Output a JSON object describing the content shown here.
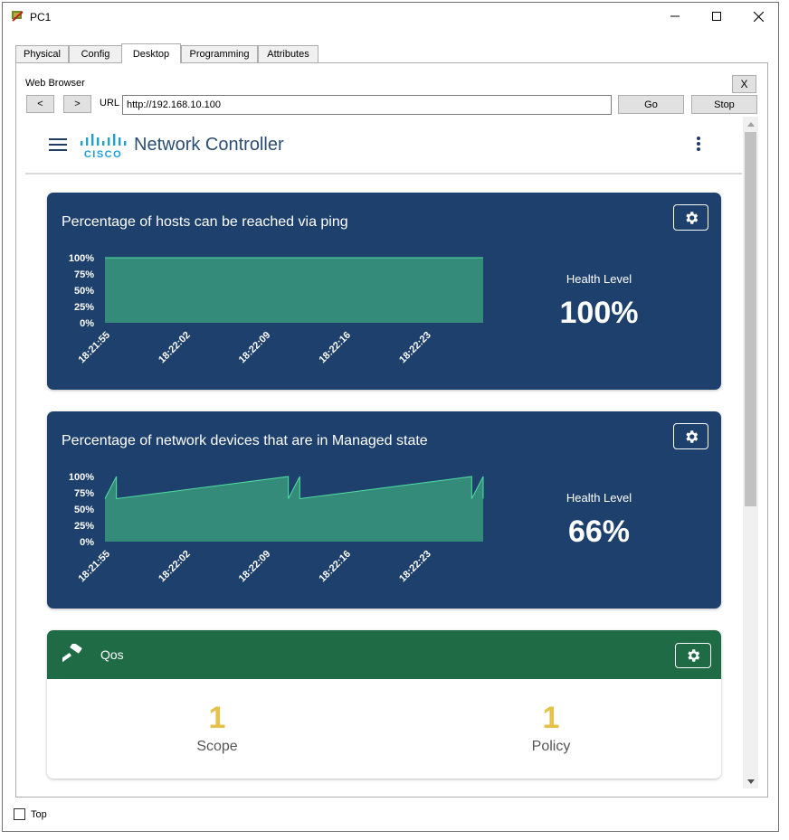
{
  "window": {
    "title": "PC1",
    "tabs": [
      {
        "label": "Physical"
      },
      {
        "label": "Config"
      },
      {
        "label": "Desktop"
      },
      {
        "label": "Programming"
      },
      {
        "label": "Attributes"
      }
    ],
    "active_tab": "Desktop",
    "top_checkbox_label": "Top",
    "top_checked": false
  },
  "browser": {
    "label": "Web Browser",
    "close_label": "X",
    "back_label": "<",
    "forward_label": ">",
    "url_label": "URL",
    "url_value": "http://192.168.10.100",
    "go_label": "Go",
    "stop_label": "Stop"
  },
  "app": {
    "title": "Network Controller",
    "logo_text": "CISCO"
  },
  "cards": {
    "ping": {
      "title": "Percentage of hosts can be reached via ping",
      "health_label": "Health Level",
      "health_value": "100%"
    },
    "managed": {
      "title": "Percentage of network devices that are in Managed state",
      "health_label": "Health Level",
      "health_value": "66%"
    },
    "qos": {
      "title": "Qos",
      "scope_value": "1",
      "scope_label": "Scope",
      "policy_value": "1",
      "policy_label": "Policy"
    }
  },
  "colors": {
    "card_blue": "#1e406d",
    "chart_fill": "#358b7a",
    "chart_line": "#4fe0a0",
    "qos_green": "#1f6b45",
    "qos_number": "#e3c14a"
  },
  "chart_data": [
    {
      "type": "area",
      "x": [
        "18:21:55",
        "18:22:02",
        "18:22:09",
        "18:22:16",
        "18:22:23"
      ],
      "y_ticks": [
        "100%",
        "75%",
        "50%",
        "25%",
        "0%"
      ],
      "ylim": [
        0,
        100
      ],
      "points": [
        {
          "x": "18:21:55",
          "y": 100
        },
        {
          "x": "18:22:28",
          "y": 100
        }
      ]
    },
    {
      "type": "area",
      "x": [
        "18:21:55",
        "18:22:02",
        "18:22:09",
        "18:22:16",
        "18:22:23"
      ],
      "y_ticks": [
        "100%",
        "75%",
        "50%",
        "25%",
        "0%"
      ],
      "ylim": [
        0,
        100
      ],
      "points": [
        {
          "x": "18:21:55",
          "y": 66
        },
        {
          "x": "18:21:56",
          "y": 100
        },
        {
          "x": "18:21:56",
          "y": 66
        },
        {
          "x": "18:22:11",
          "y": 100
        },
        {
          "x": "18:22:11",
          "y": 66
        },
        {
          "x": "18:22:12",
          "y": 100
        },
        {
          "x": "18:22:12",
          "y": 66
        },
        {
          "x": "18:22:27",
          "y": 100
        },
        {
          "x": "18:22:27",
          "y": 66
        },
        {
          "x": "18:22:28",
          "y": 100
        },
        {
          "x": "18:22:28",
          "y": 66
        }
      ]
    }
  ]
}
